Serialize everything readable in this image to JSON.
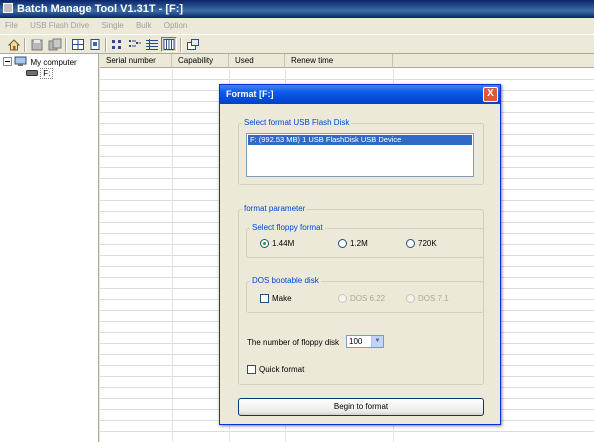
{
  "window": {
    "title": "Batch Manage Tool V1.31T  - [F:]"
  },
  "menu": [
    "File",
    "USB Flash Drive",
    "Single",
    "Bulk",
    "Option"
  ],
  "tree": {
    "root": "My computer",
    "child": "F:"
  },
  "list": {
    "columns": [
      "Serial number",
      "Capability",
      "Used",
      "Renew time"
    ]
  },
  "dialog": {
    "title": "Format [F:]",
    "close": "X",
    "usb_group_label": "Select format USB Flash Disk",
    "usb_item": "F: (992.53 MB) 1 USB FlashDisk USB Device",
    "param_group_label": "format parameter",
    "floppy_group_label": "Select floppy format",
    "floppy_options": [
      "1.44M",
      "1.2M",
      "720K"
    ],
    "floppy_selected": "1.44M",
    "dos_group_label": "DOS bootable disk",
    "make_label": "Make",
    "make_checked": false,
    "dos_options": [
      "DOS 6.22",
      "DOS 7.1"
    ],
    "floppy_count_label": "The number of floppy disk",
    "floppy_count_value": "100",
    "quick_format_label": "Quick format",
    "quick_format_checked": false,
    "begin_button": "Begin to format"
  }
}
